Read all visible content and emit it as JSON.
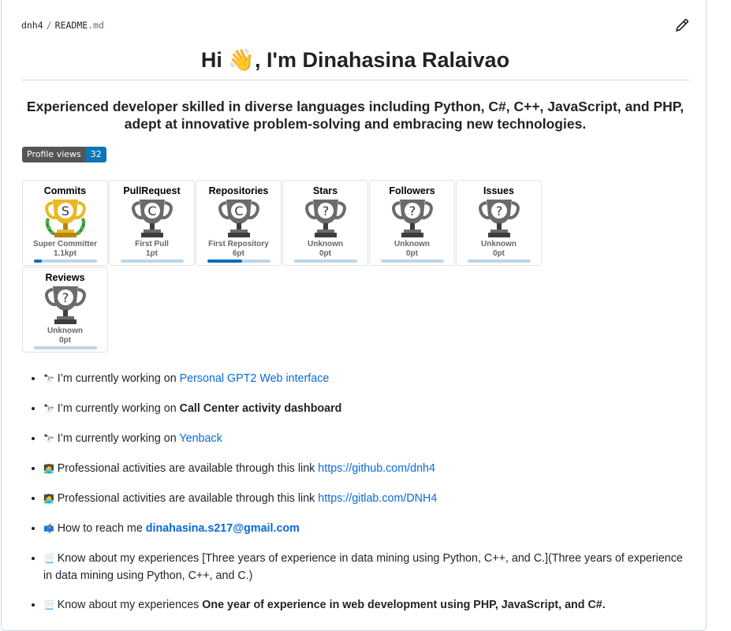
{
  "breadcrumb": {
    "owner": "dnh4",
    "separator": "/",
    "file": "README",
    "ext": ".md"
  },
  "heading": {
    "title": "Hi 👋, I'm Dinahasina Ralaivao"
  },
  "tagline": "Experienced developer skilled in diverse languages including Python, C#, C++, JavaScript, and PHP, adept at innovative problem-solving and embracing new technologies.",
  "badge": {
    "label": "Profile views",
    "value": "32"
  },
  "trophies": [
    {
      "name": "Commits",
      "rank": "S",
      "level": "Super Committer",
      "points": "1.1kpt",
      "progress": 0.12,
      "color": "gold"
    },
    {
      "name": "PullRequest",
      "rank": "C",
      "level": "First Pull",
      "points": "1pt",
      "progress": 0.0,
      "color": "gray"
    },
    {
      "name": "Repositories",
      "rank": "C",
      "level": "First Repository",
      "points": "6pt",
      "progress": 0.55,
      "color": "gray"
    },
    {
      "name": "Stars",
      "rank": "?",
      "level": "Unknown",
      "points": "0pt",
      "progress": 0.0,
      "color": "gray"
    },
    {
      "name": "Followers",
      "rank": "?",
      "level": "Unknown",
      "points": "0pt",
      "progress": 0.0,
      "color": "gray"
    },
    {
      "name": "Issues",
      "rank": "?",
      "level": "Unknown",
      "points": "0pt",
      "progress": 0.0,
      "color": "gray"
    },
    {
      "name": "Reviews",
      "rank": "?",
      "level": "Unknown",
      "points": "0pt",
      "progress": 0.0,
      "color": "gray"
    }
  ],
  "items": [
    {
      "emoji": "🔭",
      "text": "I’m currently working on ",
      "link": "Personal GPT2 Web interface",
      "bold": "",
      "after": ""
    },
    {
      "emoji": "🔭",
      "text": "I’m currently working on ",
      "link": "",
      "bold": "Call Center activity dashboard",
      "after": ""
    },
    {
      "emoji": "🔭",
      "text": "I’m currently working on ",
      "link": "Yenback",
      "bold": "",
      "after": ""
    },
    {
      "emoji": "🧑‍💻",
      "text": "Professional activities are available through this link ",
      "link": "https://github.com/dnh4",
      "bold": "",
      "after": ""
    },
    {
      "emoji": "🧑‍💻",
      "text": "Professional activities are available through this link ",
      "link": "https://gitlab.com/DNH4",
      "bold": "",
      "after": ""
    },
    {
      "emoji": "📫",
      "text": "How to reach me ",
      "link": "",
      "bold": "",
      "email": "dinahasina.s217@gmail.com",
      "after": ""
    },
    {
      "emoji": "📃",
      "text": "Know about my experiences [Three years of experience in data mining using Python, C++, and C.](Three years of experience in data mining using Python, C++, and C.)",
      "link": "",
      "bold": "",
      "after": ""
    },
    {
      "emoji": "📃",
      "text": "Know about my experiences ",
      "link": "",
      "bold": "One year of experience in web development using PHP, JavaScript, and C#.",
      "after": ""
    }
  ],
  "colors": {
    "link": "#0969da",
    "badge_value": "#0e75b6",
    "badge_label": "#555555",
    "gold": "#e8b923"
  }
}
